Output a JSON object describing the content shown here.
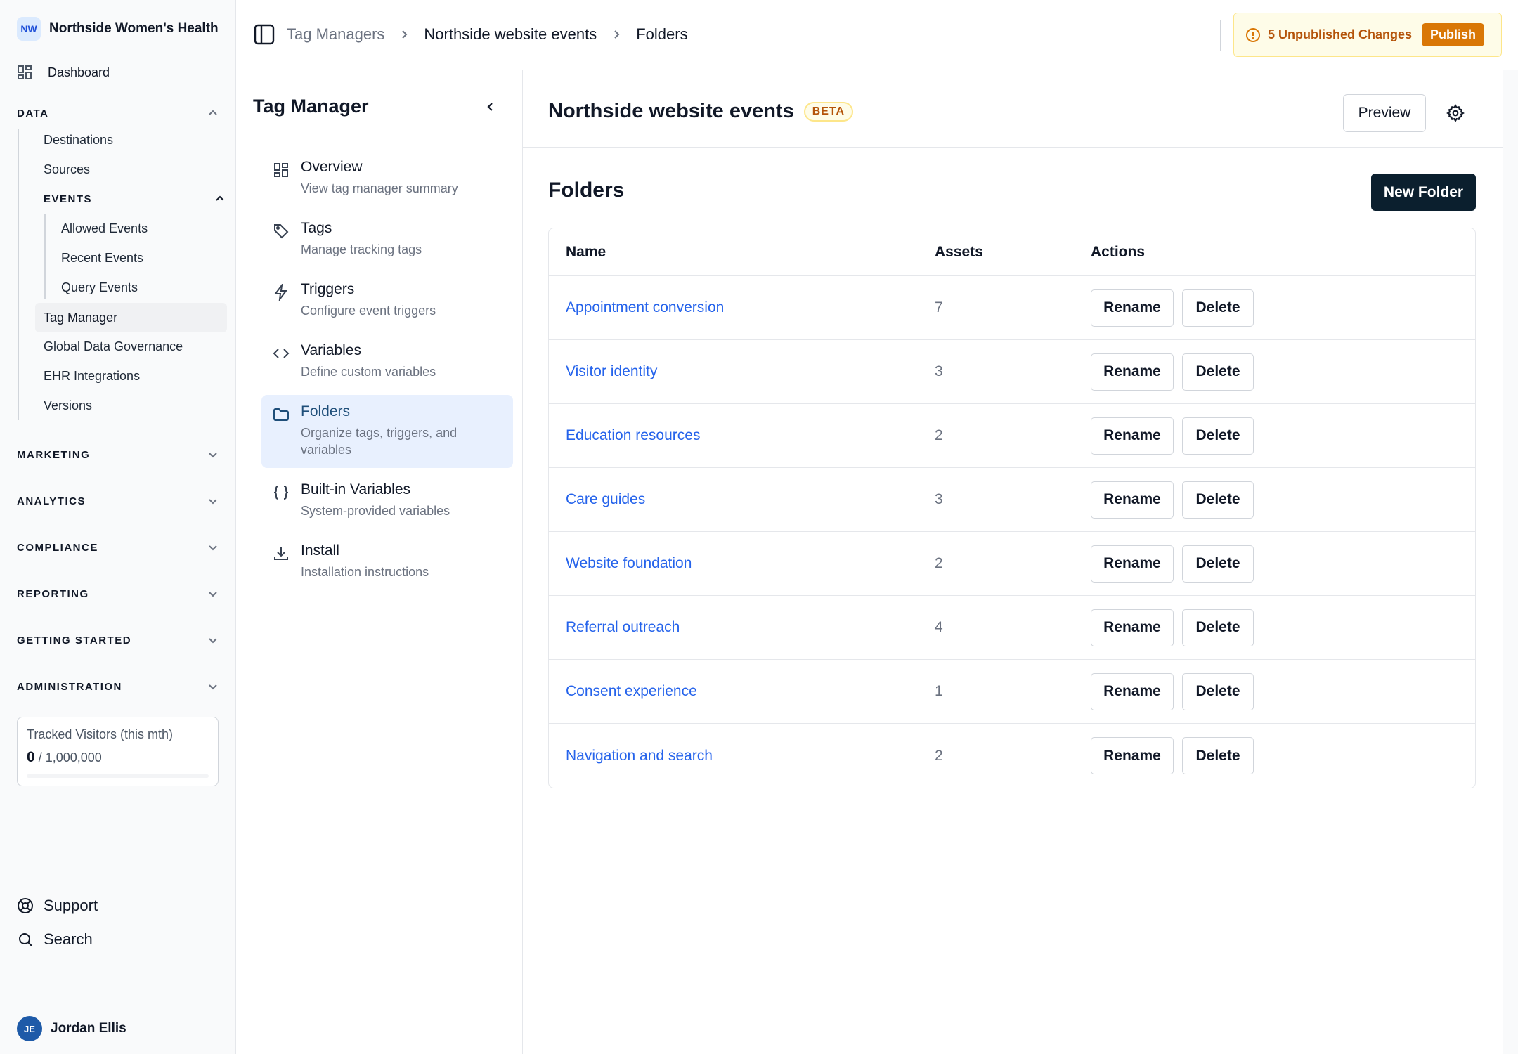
{
  "org": {
    "initials": "NW",
    "name": "Northside Women's Health"
  },
  "sidebar": {
    "dashboard": "Dashboard",
    "data_section": "DATA",
    "data_items": [
      "Destinations",
      "Sources"
    ],
    "events_section": "EVENTS",
    "events_items": [
      "Allowed Events",
      "Recent Events",
      "Query Events"
    ],
    "more_items": [
      "Tag Manager",
      "Global Data Governance",
      "EHR Integrations",
      "Versions"
    ],
    "sections": [
      "MARKETING",
      "ANALYTICS",
      "COMPLIANCE",
      "REPORTING",
      "GETTING STARTED",
      "ADMINISTRATION"
    ],
    "usage": {
      "label": "Tracked Visitors (this mth)",
      "value": "0",
      "limit": "/ 1,000,000",
      "fraction": 0.0
    },
    "support": "Support",
    "search": "Search",
    "user": {
      "initials": "JE",
      "name": "Jordan Ellis"
    }
  },
  "header": {
    "breadcrumbs": [
      "Tag Managers",
      "Northside website events",
      "Folders"
    ],
    "changes_text": "5 Unpublished Changes",
    "publish_label": "Publish"
  },
  "tag_manager": {
    "title": "Tag Manager",
    "items": [
      {
        "title": "Overview",
        "desc": "View tag manager summary",
        "icon": "grid-icon"
      },
      {
        "title": "Tags",
        "desc": "Manage tracking tags",
        "icon": "tag-icon"
      },
      {
        "title": "Triggers",
        "desc": "Configure event triggers",
        "icon": "bolt-icon"
      },
      {
        "title": "Variables",
        "desc": "Define custom variables",
        "icon": "code-icon"
      },
      {
        "title": "Folders",
        "desc": "Organize tags, triggers, and variables",
        "icon": "folder-icon"
      },
      {
        "title": "Built-in Variables",
        "desc": "System-provided variables",
        "icon": "braces-icon"
      },
      {
        "title": "Install",
        "desc": "Installation instructions",
        "icon": "download-icon"
      }
    ]
  },
  "main": {
    "title": "Northside website events",
    "badge": "BETA",
    "preview_label": "Preview",
    "section_title": "Folders",
    "new_folder_label": "New Folder",
    "columns": [
      "Name",
      "Assets",
      "Actions"
    ],
    "rename_label": "Rename",
    "delete_label": "Delete",
    "rows": [
      {
        "name": "Appointment conversion",
        "assets": "7"
      },
      {
        "name": "Visitor identity",
        "assets": "3"
      },
      {
        "name": "Education resources",
        "assets": "2"
      },
      {
        "name": "Care guides",
        "assets": "3"
      },
      {
        "name": "Website foundation",
        "assets": "2"
      },
      {
        "name": "Referral outreach",
        "assets": "4"
      },
      {
        "name": "Consent experience",
        "assets": "1"
      },
      {
        "name": "Navigation and search",
        "assets": "2"
      }
    ]
  },
  "colors": {
    "accent": "#2563eb",
    "brand_dark": "#0b1f2e",
    "warning": "#d97706",
    "active_bg": "#e8f0fe"
  }
}
